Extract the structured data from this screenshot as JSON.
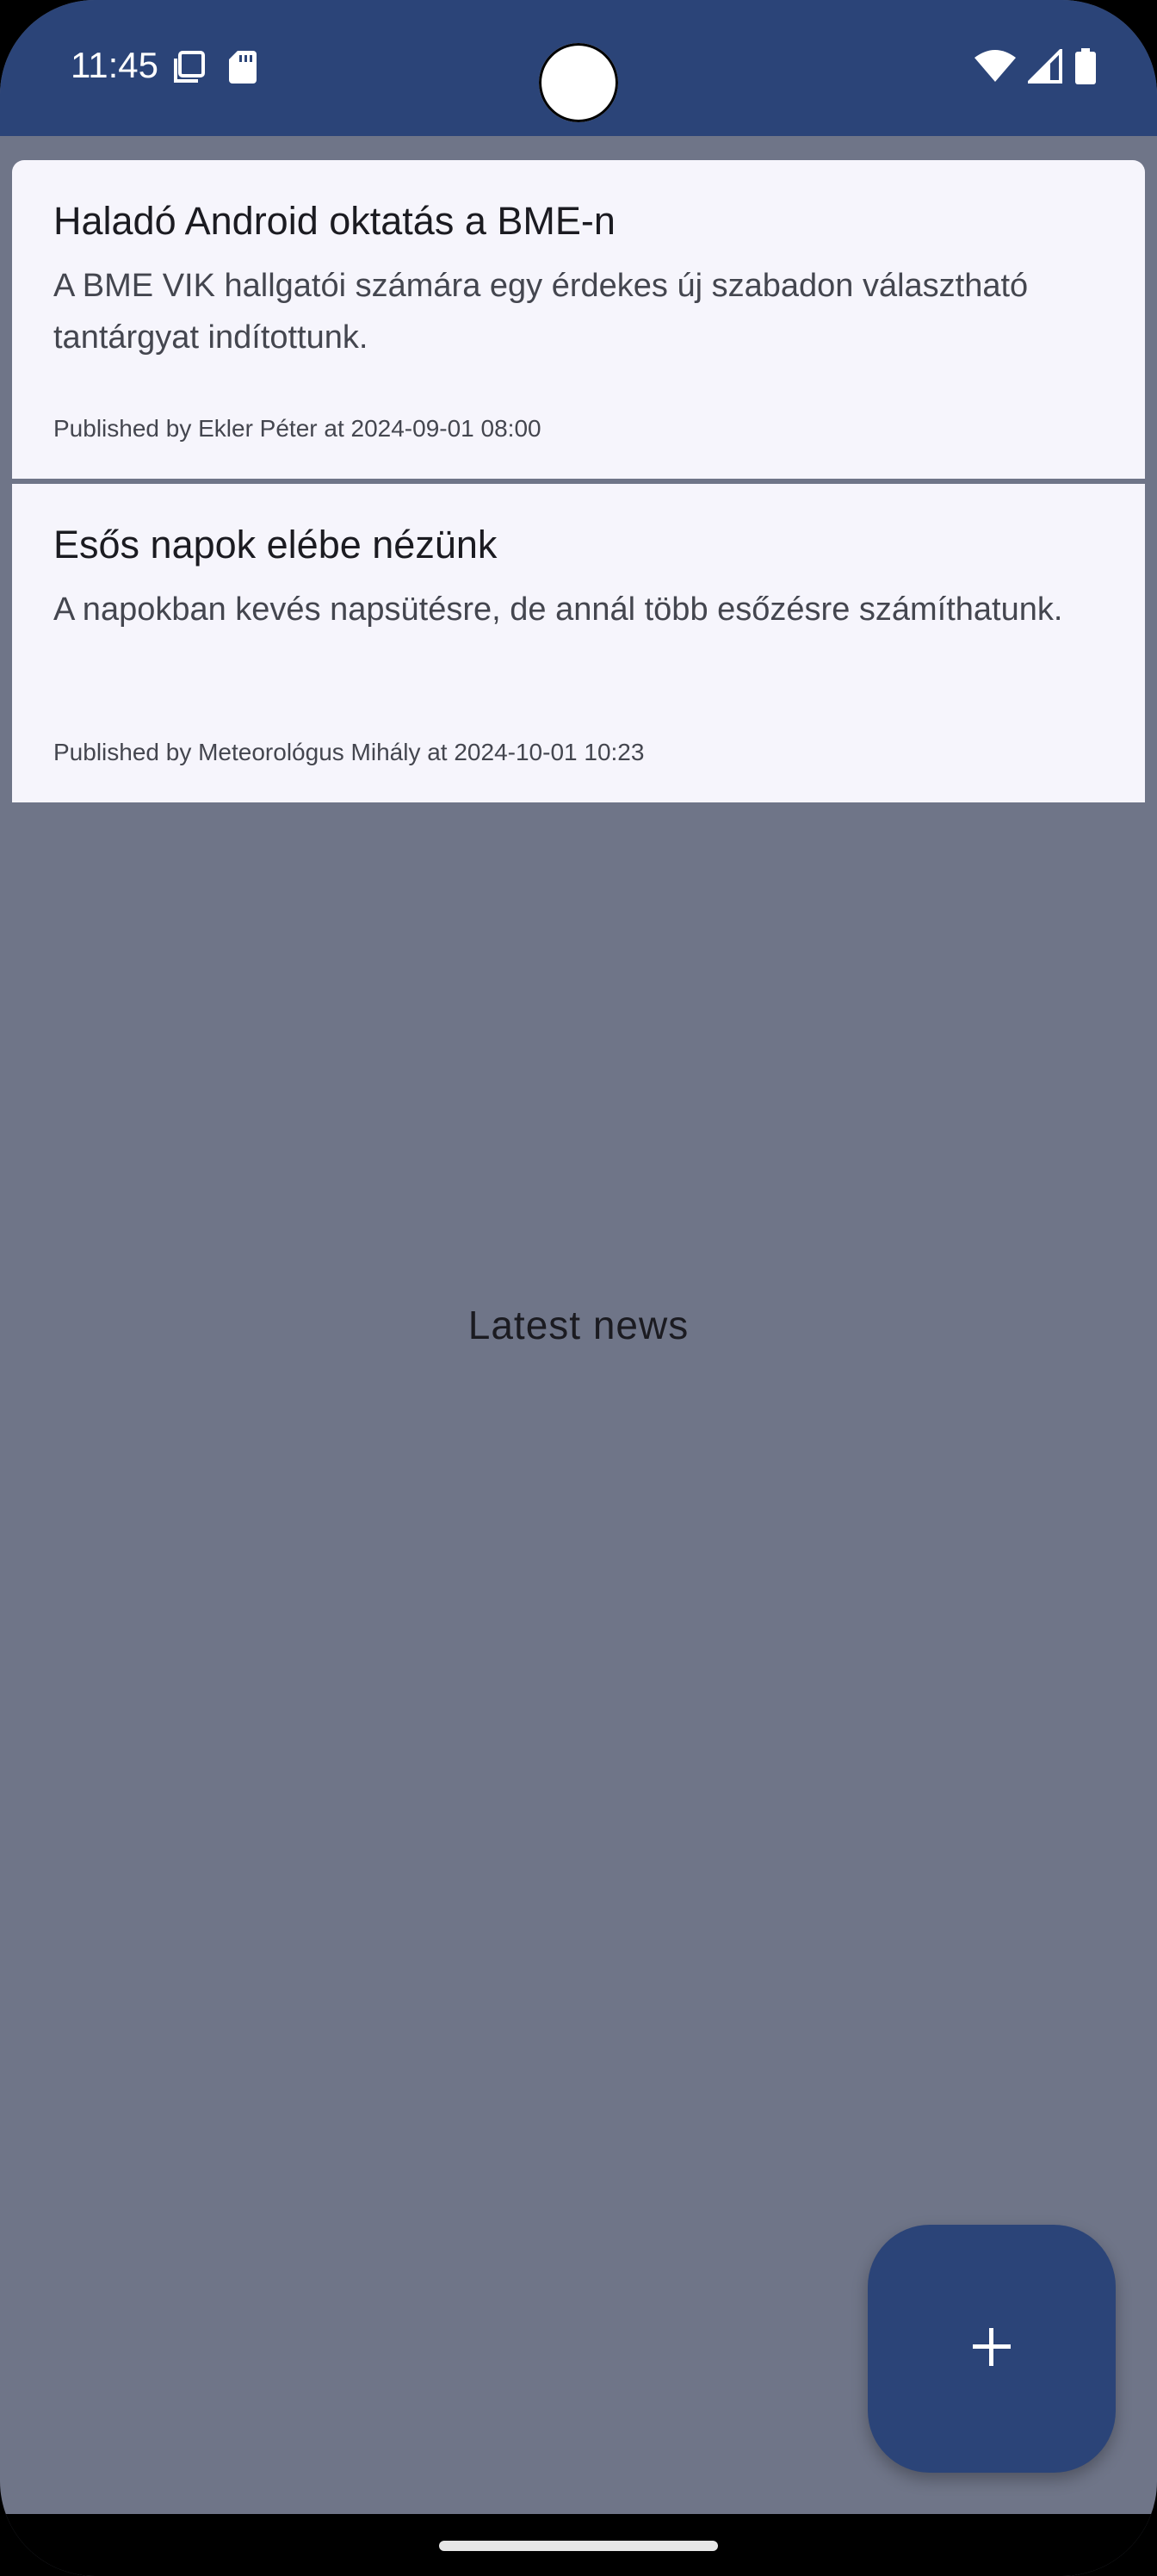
{
  "status_bar": {
    "time": "11:45",
    "icons_left": [
      "screenshot-icon",
      "sd-card-icon"
    ],
    "icons_right": [
      "wifi-icon",
      "cell-signal-icon",
      "battery-icon"
    ],
    "color": "#2b4478"
  },
  "news": {
    "items": [
      {
        "title": "Haladó Android oktatás a BME-n",
        "body": "A BME VIK hallgatói számára egy érdekes új szabadon választható tantárgyat indítottunk.",
        "meta": "Published by Ekler Péter at 2024-09-01 08:00"
      },
      {
        "title": "Esős napok elébe nézünk",
        "body": "A napokban kevés napsütésre, de annál több esőzésre számíthatunk.",
        "meta": "Published by Meteorológus Mihály at 2024-10-01 10:23"
      }
    ]
  },
  "background_label": "Latest news",
  "fab": {
    "icon": "plus-icon",
    "color": "#2b4478"
  },
  "colors": {
    "background": "#6f7588",
    "card": "#f6f5fc",
    "accent": "#2b4478"
  }
}
